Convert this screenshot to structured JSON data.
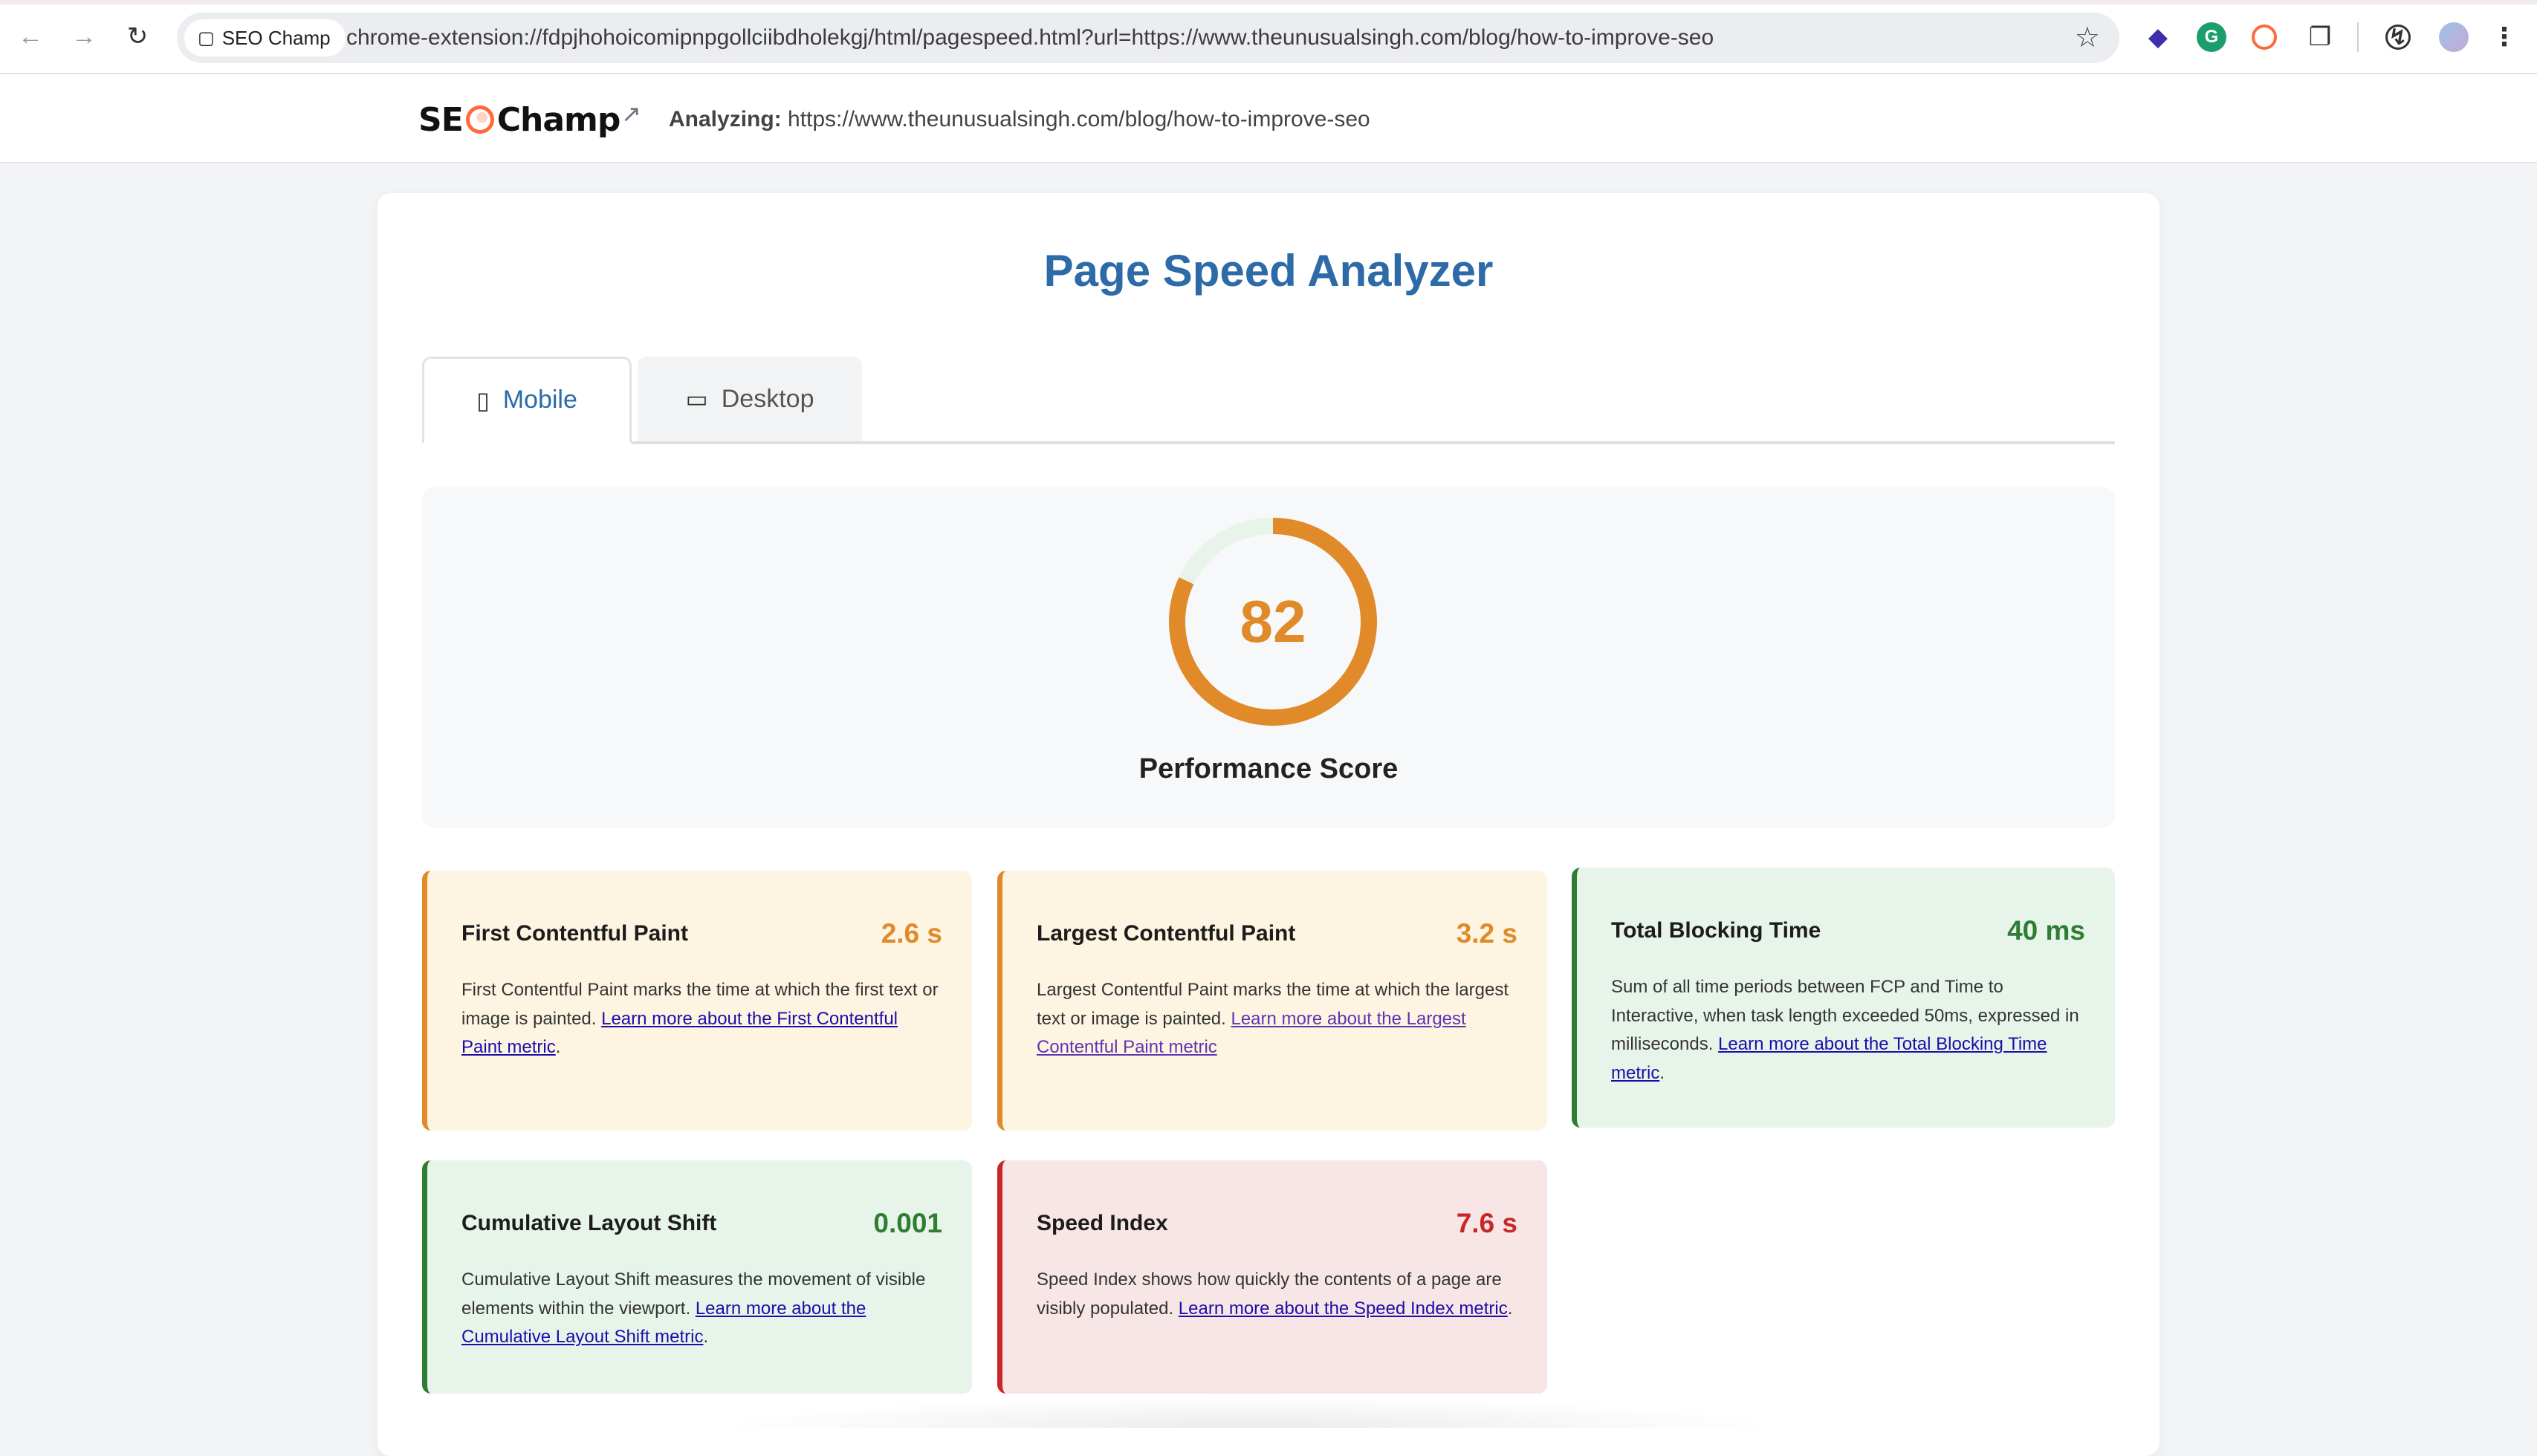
{
  "browser": {
    "tab_chip_label": "SEO Champ",
    "url": "chrome-extension://fdpjhohoicomipnpgollciibdholekgj/html/pagespeed.html?url=https://www.theunusualsingh.com/blog/how-to-improve-seo"
  },
  "header": {
    "logo_left": "SE",
    "logo_right": "Champ",
    "analyzing_label": "Analyzing:",
    "analyzing_url": "https://www.theunusualsingh.com/blog/how-to-improve-seo"
  },
  "main": {
    "title": "Page Speed Analyzer",
    "tabs": [
      {
        "label": "Mobile",
        "icon": "mobile-phone-icon",
        "active": true
      },
      {
        "label": "Desktop",
        "icon": "laptop-icon",
        "active": false
      }
    ],
    "score": {
      "value": "82",
      "fraction": 0.82,
      "label": "Performance Score",
      "color": "#e08a2a",
      "track_color": "#e8f3ea"
    },
    "metrics": [
      {
        "name": "First Contentful Paint",
        "value": "2.6 s",
        "status": "orange",
        "desc": "First Contentful Paint marks the time at which the first text or image is painted. ",
        "link": "Learn more about the First Contentful Paint metric",
        "tail": "."
      },
      {
        "name": "Largest Contentful Paint",
        "value": "3.2 s",
        "status": "orange",
        "desc": "Largest Contentful Paint marks the time at which the largest text or image is painted. ",
        "link": "Learn more about the Largest Contentful Paint metric",
        "tail": ""
      },
      {
        "name": "Total Blocking Time",
        "value": "40 ms",
        "status": "green",
        "desc": "Sum of all time periods between FCP and Time to Interactive, when task length exceeded 50ms, expressed in milliseconds. ",
        "link": "Learn more about the Total Blocking Time metric",
        "tail": "."
      },
      {
        "name": "Cumulative Layout Shift",
        "value": "0.001",
        "status": "green",
        "desc": "Cumulative Layout Shift measures the movement of visible elements within the viewport. ",
        "link": "Learn more about the Cumulative Layout Shift metric",
        "tail": "."
      },
      {
        "name": "Speed Index",
        "value": "7.6 s",
        "status": "red",
        "desc": "Speed Index shows how quickly the contents of a page are visibly populated. ",
        "link": "Learn more about the Speed Index metric",
        "tail": "."
      }
    ]
  }
}
